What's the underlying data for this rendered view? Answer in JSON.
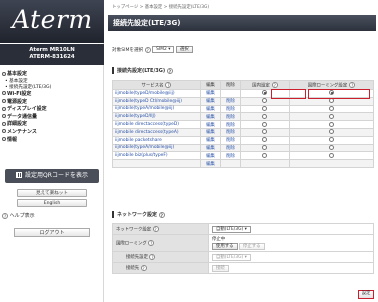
{
  "sidebar": {
    "logo": "Aterm",
    "model_line1": "Aterm MR10LN",
    "model_line2": "ATERM-831624",
    "menu": [
      {
        "label": "基本設定",
        "sub": [
          "基本設定",
          "接続先設定(LTE/3G)"
        ]
      },
      {
        "label": "Wi-Fi設定",
        "sub": []
      },
      {
        "label": "電源設定",
        "sub": []
      },
      {
        "label": "ディスプレイ設定",
        "sub": []
      },
      {
        "label": "データ通信量",
        "sub": []
      },
      {
        "label": "詳細設定",
        "sub": []
      },
      {
        "label": "メンテナンス",
        "sub": []
      },
      {
        "label": "情報",
        "sub": []
      }
    ],
    "qr_button": "設定用QRコードを表示",
    "easy_button": "見えて楽ねット",
    "lang_button": "English",
    "help_label": "ヘルプ表示",
    "logout_button": "ログアウト"
  },
  "breadcrumb": "トップページ > 基本設定 > 接続先設定(LTE/3G)",
  "page_title": "接続先設定(LTE/3G)",
  "sim": {
    "label": "対象SIMを選択",
    "value": "SIM2",
    "select_button": "選択"
  },
  "profile_section": {
    "title": "接続先設定(LTE/3G)",
    "help": "?"
  },
  "table": {
    "headers": [
      "サービス名",
      "編集",
      "削除",
      "国内設定",
      "国際ローミング設定"
    ],
    "rows": [
      {
        "name": "iijmobile(typeD/mobile@iij)",
        "edit": "編集",
        "del": "",
        "domestic": true,
        "roaming": true
      },
      {
        "name": "iijmobile(typeD Ctl/mobile@iij)",
        "edit": "編集",
        "del": "削除",
        "domestic": false,
        "roaming": false
      },
      {
        "name": "iijmobile(typeA/mobile@iij)",
        "edit": "編集",
        "del": "削除",
        "domestic": false,
        "roaming": false
      },
      {
        "name": "iijmobile(typeD/IIJ)",
        "edit": "編集",
        "del": "削除",
        "domestic": false,
        "roaming": false
      },
      {
        "name": "iijmobile directaccess(typeD)",
        "edit": "編集",
        "del": "削除",
        "domestic": false,
        "roaming": false
      },
      {
        "name": "iijmobile directaccess(typeA)",
        "edit": "編集",
        "del": "削除",
        "domestic": false,
        "roaming": false
      },
      {
        "name": "iijmobile packetshare",
        "edit": "編集",
        "del": "削除",
        "domestic": false,
        "roaming": false
      },
      {
        "name": "iijmobile(typeA/mobile@iij)",
        "edit": "編集",
        "del": "削除",
        "domestic": false,
        "roaming": false
      },
      {
        "name": "iijmobile biz(plus/typeF)",
        "edit": "編集",
        "del": "削除",
        "domestic": false,
        "roaming": false
      },
      {
        "name": "",
        "edit": "編集",
        "del": "",
        "domestic": null,
        "roaming": null
      }
    ]
  },
  "network": {
    "title": "ネットワーク設定",
    "rows": [
      {
        "label": "ネットワーク設定",
        "value": "自動(LTE/3G)"
      },
      {
        "label": "国際ローミング",
        "value": "停止中",
        "btn1": "使用する",
        "btn2": "停止する"
      },
      {
        "label": "接続先設定",
        "value": "自動(LTE/3G)"
      },
      {
        "label": "接続先",
        "value": "接続"
      }
    ]
  },
  "save_button": "設定",
  "colors": {
    "header": "#2c313c",
    "highlight": "#cc1f2e",
    "link": "#2750a8"
  }
}
